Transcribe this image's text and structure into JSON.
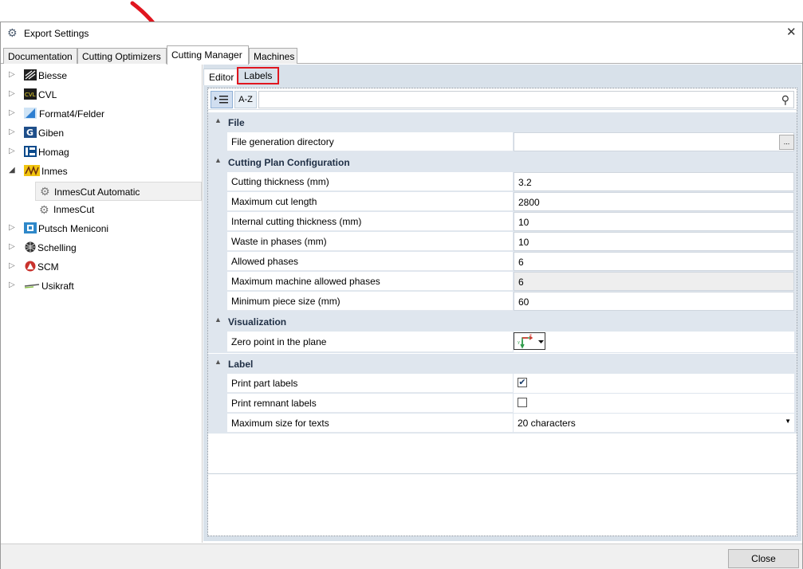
{
  "window": {
    "title": "Export Settings",
    "icon": "gear-icon",
    "close_glyph": "✕"
  },
  "top_tabs": [
    {
      "label": "Documentation"
    },
    {
      "label": "Cutting Optimizers"
    },
    {
      "label": "Cutting Manager",
      "active": true
    },
    {
      "label": "Machines"
    }
  ],
  "tree": [
    {
      "label": "Biesse",
      "expanded": false,
      "logo": "biesse-logo"
    },
    {
      "label": "CVL",
      "expanded": false,
      "logo": "cvl-logo"
    },
    {
      "label": "Format4/Felder",
      "expanded": false,
      "logo": "format4-logo"
    },
    {
      "label": "Giben",
      "expanded": false,
      "logo": "giben-logo"
    },
    {
      "label": "Homag",
      "expanded": false,
      "logo": "homag-logo"
    },
    {
      "label": "Inmes",
      "expanded": true,
      "logo": "inmes-logo"
    },
    {
      "label": "InmesCut Automatic",
      "child": true,
      "selected": true,
      "logo": "gear-icon"
    },
    {
      "label": "InmesCut",
      "child": true,
      "logo": "gear-icon"
    },
    {
      "label": "Putsch Meniconi",
      "expanded": false,
      "logo": "putsch-logo"
    },
    {
      "label": "Schelling",
      "expanded": false,
      "logo": "schelling-logo"
    },
    {
      "label": "SCM",
      "expanded": false,
      "logo": "scm-logo"
    },
    {
      "label": "Usikraft",
      "expanded": false,
      "logo": "usikraft-logo"
    }
  ],
  "sub_tabs": {
    "editor": "Editor",
    "labels": "Labels"
  },
  "toolbar": {
    "categorized_icon": "categorized-list-icon",
    "az_label": "A-Z",
    "search_placeholder": "",
    "search_icon": "search-icon"
  },
  "property_grid": {
    "file": {
      "title": "File",
      "rows": [
        {
          "name": "File generation directory",
          "value": "",
          "button": "..."
        }
      ]
    },
    "cutting": {
      "title": "Cutting Plan Configuration",
      "rows": [
        {
          "name": "Cutting thickness (mm)",
          "value": "3.2"
        },
        {
          "name": "Maximum cut length",
          "value": "2800"
        },
        {
          "name": "Internal cutting thickness (mm)",
          "value": "10"
        },
        {
          "name": "Waste in phases (mm)",
          "value": "10"
        },
        {
          "name": "Allowed phases",
          "value": "6"
        },
        {
          "name": "Maximum machine allowed phases",
          "value": "6",
          "readonly": true
        },
        {
          "name": "Minimum piece size (mm)",
          "value": "60"
        }
      ]
    },
    "visualization": {
      "title": "Visualization",
      "rows": [
        {
          "name": "Zero point in the plane",
          "icon": "axis-origin-icon"
        }
      ]
    },
    "label": {
      "title": "Label",
      "rows": [
        {
          "name": "Print part labels",
          "checked": true
        },
        {
          "name": "Print remnant labels",
          "checked": false
        },
        {
          "name": "Maximum size for texts",
          "value": "20 characters"
        }
      ]
    }
  },
  "footer": {
    "close_label": "Close"
  },
  "colors": {
    "accent_red": "#e0161f",
    "category_bg": "#dfe6ee",
    "panel_bg": "#d8e1ea"
  }
}
